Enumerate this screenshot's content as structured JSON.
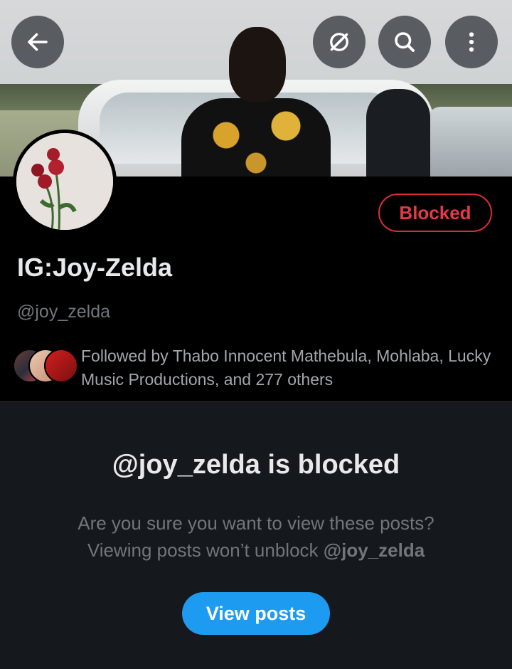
{
  "header": {
    "back_icon": "arrow-left-icon",
    "grok_icon": "slashed-circle-icon",
    "search_icon": "search-icon",
    "more_icon": "more-vertical-icon"
  },
  "profile": {
    "display_name": "IG:Joy-Zelda",
    "handle": "@joy_zelda",
    "blocked_label": "Blocked",
    "followed_by": "Followed by Thabo Innocent Mathebula, Mohlaba, Lucky Music Productions, and 277 others"
  },
  "blocked_notice": {
    "title": "@joy_zelda is blocked",
    "line1": "Are you sure you want to view these posts?",
    "line2_prefix": "Viewing posts won’t unblock ",
    "line2_handle": "@joy_zelda",
    "button_label": "View posts"
  },
  "colors": {
    "background": "#15181c",
    "blocked_red": "#df2b3a",
    "accent_blue": "#1d9bf0"
  }
}
